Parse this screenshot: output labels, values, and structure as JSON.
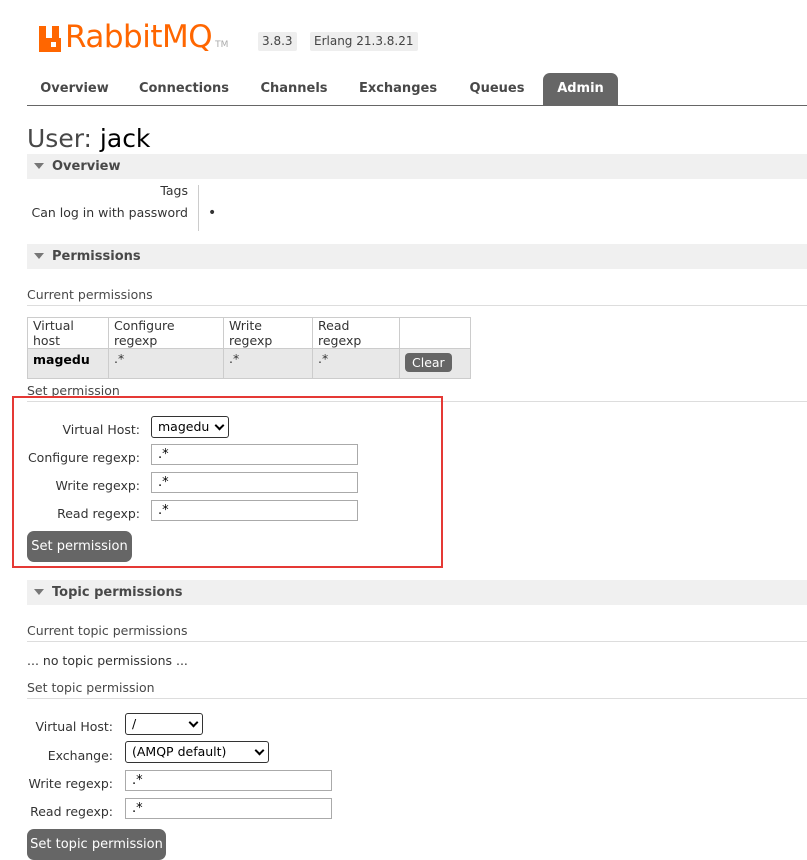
{
  "header": {
    "logo_text": "RabbitMQ",
    "logo_tm": "TM",
    "rabbitmq_version": "3.8.3",
    "erlang_version": "Erlang 21.3.8.21",
    "brand_color": "#ff6600"
  },
  "tabs": [
    {
      "label": "Overview",
      "active": false
    },
    {
      "label": "Connections",
      "active": false
    },
    {
      "label": "Channels",
      "active": false
    },
    {
      "label": "Exchanges",
      "active": false
    },
    {
      "label": "Queues",
      "active": false
    },
    {
      "label": "Admin",
      "active": true
    }
  ],
  "page": {
    "title_prefix": "User:",
    "username": "jack"
  },
  "overview": {
    "heading": "Overview",
    "tags_label": "Tags",
    "tags_value": "",
    "password_label": "Can log in with password",
    "password_value": "•"
  },
  "permissions": {
    "heading": "Permissions",
    "current_label": "Current permissions",
    "columns": [
      "Virtual host",
      "Configure regexp",
      "Write regexp",
      "Read regexp"
    ],
    "rows": [
      {
        "vhost": "magedu",
        "configure": ".*",
        "write": ".*",
        "read": ".*",
        "action": "Clear"
      }
    ],
    "set_label": "Set permission",
    "form": {
      "vhost_label": "Virtual Host:",
      "vhost_value": "magedu",
      "configure_label": "Configure regexp:",
      "configure_value": ".*",
      "write_label": "Write regexp:",
      "write_value": ".*",
      "read_label": "Read regexp:",
      "read_value": ".*",
      "submit": "Set permission"
    }
  },
  "topic_permissions": {
    "heading": "Topic permissions",
    "current_label": "Current topic permissions",
    "empty_text": "... no topic permissions ...",
    "set_label": "Set topic permission",
    "form": {
      "vhost_label": "Virtual Host:",
      "vhost_value": "/",
      "exchange_label": "Exchange:",
      "exchange_value": "(AMQP default)",
      "write_label": "Write regexp:",
      "write_value": ".*",
      "read_label": "Read regexp:",
      "read_value": ".*",
      "submit": "Set topic permission"
    }
  },
  "annotation": {
    "highlight_color": "#e53935"
  }
}
